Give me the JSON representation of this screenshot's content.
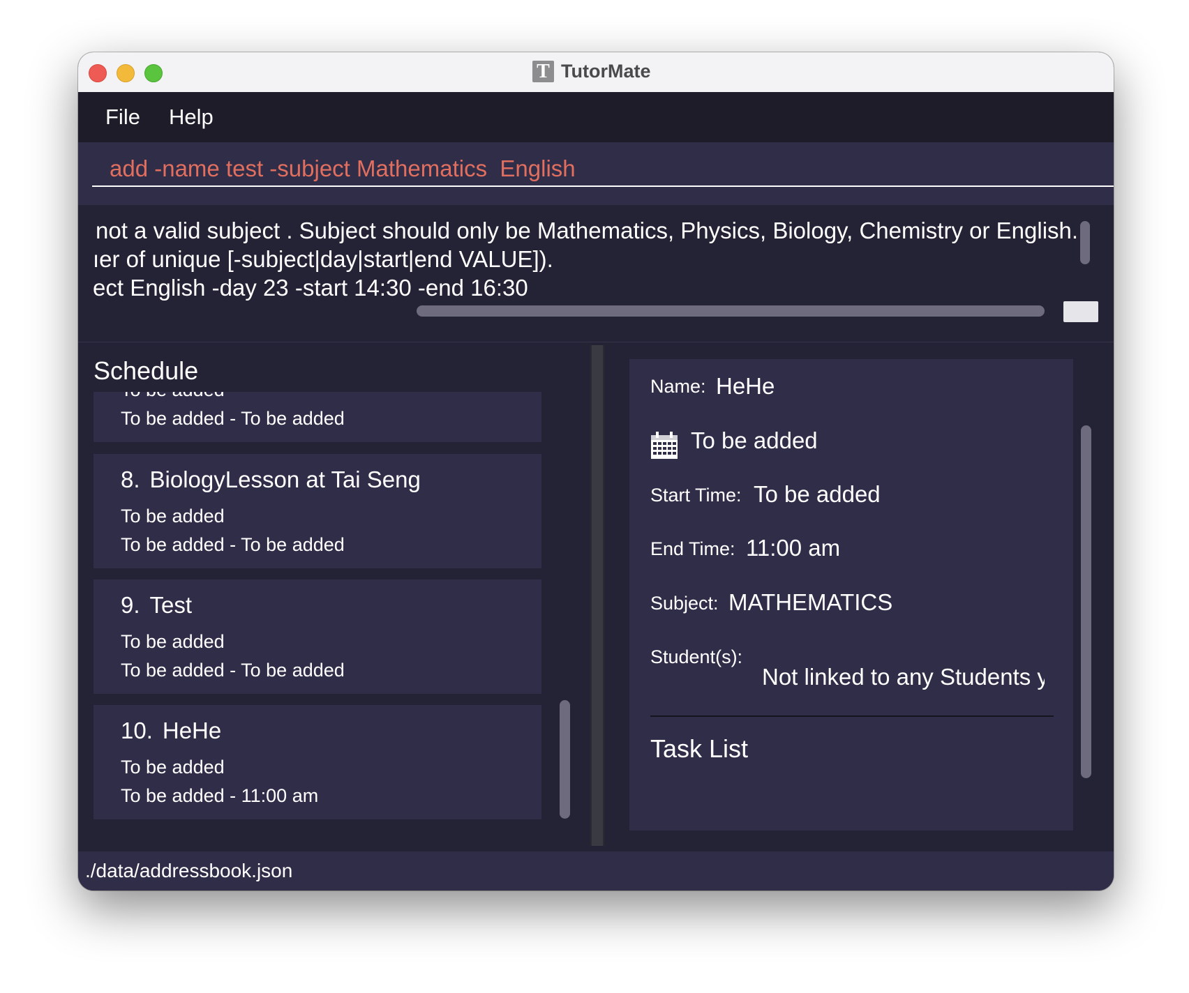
{
  "window": {
    "title": "TutorMate",
    "logo_letter": "T"
  },
  "menu": {
    "file": "File",
    "help": "Help"
  },
  "command": {
    "value": "add -name test -subject Mathematics  English"
  },
  "result": {
    "lines": [
      " not a valid subject . Subject should only be Mathematics, Physics, Biology, Chemistry or English.",
      "ıer of unique [-subject|day|start|end VALUE]).",
      "ect English -day 23 -start 14:30 -end 16:30"
    ]
  },
  "schedule": {
    "title": "Schedule",
    "partial_card": {
      "line1": "To be added",
      "line2": "To be added - To be added"
    },
    "cards": [
      {
        "index": "8.",
        "name": "BiologyLesson at Tai Seng",
        "line1": "To be added",
        "line2": "To be added - To be added"
      },
      {
        "index": "9.",
        "name": "Test",
        "line1": "To be added",
        "line2": "To be added - To be added"
      },
      {
        "index": "10.",
        "name": "HeHe",
        "line1": "To be added",
        "line2": "To be added - 11:00 am"
      }
    ]
  },
  "details": {
    "name_label": "Name:",
    "name_value": "HeHe",
    "day_value": "To be added",
    "start_label": "Start Time:",
    "start_value": "To be added",
    "end_label": "End Time:",
    "end_value": "11:00 am",
    "subject_label": "Subject:",
    "subject_value": "MATHEMATICS",
    "students_label": "Student(s):",
    "students_value": "Not linked to any Students yet",
    "task_title": "Task List"
  },
  "status": {
    "path": "./data/addressbook.json"
  }
}
